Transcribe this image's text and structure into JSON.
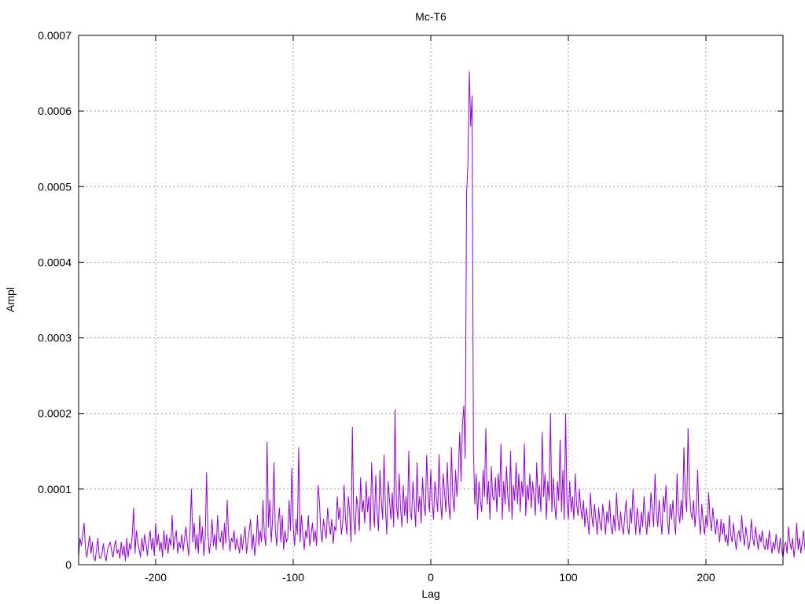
{
  "chart_data": {
    "type": "line",
    "title": "Mc-T6",
    "xlabel": "Lag",
    "ylabel": "Ampl",
    "xlim": [
      -256,
      256
    ],
    "ylim": [
      0,
      0.0007
    ],
    "grid": true,
    "line_color": "#9400d3",
    "x_ticks": [
      {
        "value": -200,
        "label": "-200"
      },
      {
        "value": -100,
        "label": "-100"
      },
      {
        "value": 0,
        "label": "0"
      },
      {
        "value": 100,
        "label": "100"
      },
      {
        "value": 200,
        "label": "200"
      }
    ],
    "y_ticks": [
      {
        "value": 0,
        "label": "0"
      },
      {
        "value": 0.0001,
        "label": "0.0001"
      },
      {
        "value": 0.0002,
        "label": "0.0002"
      },
      {
        "value": 0.0003,
        "label": "0.0003"
      },
      {
        "value": 0.0004,
        "label": "0.0004"
      },
      {
        "value": 0.0005,
        "label": "0.0005"
      },
      {
        "value": 0.0006,
        "label": "0.0006"
      },
      {
        "value": 0.0007,
        "label": "0.0007"
      }
    ],
    "series": [
      {
        "x_start": -256,
        "x_step": 1,
        "values": [
          1e-05,
          3.5e-05,
          2.5e-05,
          4e-05,
          5.5e-05,
          2e-05,
          1e-05,
          2.5e-05,
          3.8e-05,
          1.5e-05,
          3e-05,
          1e-05,
          5e-06,
          2e-05,
          3.5e-05,
          1e-05,
          8e-06,
          1.5e-05,
          2.8e-05,
          1.2e-05,
          5e-06,
          2e-05,
          2.5e-05,
          3e-05,
          1.8e-05,
          1e-05,
          2.5e-05,
          3.2e-05,
          1.5e-05,
          2e-05,
          8e-06,
          3e-05,
          1.2e-05,
          2.5e-05,
          5e-06,
          3.5e-05,
          1e-05,
          2.8e-05,
          2e-05,
          4e-05,
          7.5e-05,
          1.5e-05,
          4.5e-05,
          3e-05,
          2e-05,
          1e-05,
          3.5e-05,
          1.8e-05,
          4e-05,
          2.8e-05,
          1.2e-05,
          3e-05,
          4.5e-05,
          2e-05,
          3.5e-05,
          1.2e-05,
          5.5e-05,
          2.5e-05,
          4e-05,
          1.8e-05,
          3e-05,
          1e-05,
          4.5e-05,
          2e-05,
          4e-05,
          1.5e-05,
          3.5e-05,
          2.5e-05,
          6.5e-05,
          2e-05,
          3.5e-05,
          4.5e-05,
          1.5e-05,
          3e-05,
          2.2e-05,
          4e-05,
          1.8e-05,
          3.5e-05,
          5e-05,
          2.8e-05,
          1.2e-05,
          4.5e-05,
          0.0001,
          3e-05,
          5.5e-05,
          2e-05,
          4e-05,
          1.5e-05,
          6.5e-05,
          2.8e-05,
          5e-05,
          1.2e-05,
          3.5e-05,
          0.000122,
          4e-05,
          1.5e-05,
          3e-05,
          6e-05,
          2.5e-05,
          4e-05,
          2e-05,
          6.5e-05,
          3.5e-05,
          3e-05,
          4.5e-05,
          2e-05,
          5.5e-05,
          2.8e-05,
          8.5e-05,
          4e-05,
          1.8e-05,
          3.5e-05,
          3e-05,
          4.5e-05,
          2e-05,
          3.5e-05,
          2.5e-05,
          1.5e-05,
          4e-05,
          2e-05,
          3.5e-05,
          5e-05,
          1.5e-05,
          3e-05,
          4.5e-05,
          6e-05,
          2e-05,
          4e-05,
          1.2e-05,
          3e-05,
          6.5e-05,
          2.5e-05,
          4.5e-05,
          3e-05,
          8.5e-05,
          4e-05,
          2.5e-05,
          0.000162,
          5e-05,
          8.5e-05,
          3e-05,
          6e-05,
          0.000135,
          4.5e-05,
          2.5e-05,
          5.5e-05,
          7.5e-05,
          3e-05,
          6.5e-05,
          2e-05,
          4.5e-05,
          3e-05,
          3.5e-05,
          8.5e-05,
          4.5e-05,
          0.000128,
          5e-05,
          2.5e-05,
          6e-05,
          4e-05,
          0.000155,
          3e-05,
          6.5e-05,
          4e-05,
          2e-05,
          4.5e-05,
          3.5e-05,
          6.5e-05,
          2.5e-05,
          4e-05,
          5.5e-05,
          3e-05,
          4.5e-05,
          2.5e-05,
          0.000105,
          8.5e-05,
          4.5e-05,
          3e-05,
          6e-05,
          4.5e-05,
          3.5e-05,
          7.5e-05,
          5.5e-05,
          4e-05,
          6e-05,
          2.8e-05,
          5e-05,
          4.5e-05,
          9e-05,
          6e-05,
          7.5e-05,
          4e-05,
          5.5e-05,
          0.000105,
          6e-05,
          4e-05,
          9e-05,
          7e-05,
          3e-05,
          0.000182,
          6e-05,
          4e-05,
          9e-05,
          7.5e-05,
          4.5e-05,
          0.000115,
          7e-05,
          8.5e-05,
          5.5e-05,
          0.00011,
          7e-05,
          9e-05,
          4.5e-05,
          0.000135,
          8e-05,
          5e-05,
          0.000118,
          7e-05,
          4.5e-05,
          0.000125,
          8.5e-05,
          6e-05,
          0.000145,
          7.5e-05,
          4e-05,
          0.00011,
          8.5e-05,
          6e-05,
          9.5e-05,
          5e-05,
          0.000205,
          8e-05,
          6e-05,
          0.00012,
          7.5e-05,
          5e-05,
          0.000105,
          6.5e-05,
          9e-05,
          5.5e-05,
          0.00015,
          7e-05,
          6e-05,
          0.00011,
          8e-05,
          5e-05,
          0.000135,
          7e-05,
          9e-05,
          5.5e-05,
          0.000115,
          8e-05,
          6.5e-05,
          0.000145,
          9e-05,
          7e-05,
          0.000125,
          8.5e-05,
          6e-05,
          0.00011,
          9e-05,
          7e-05,
          0.000145,
          8.5e-05,
          6e-05,
          0.00012,
          9.5e-05,
          7e-05,
          0.000135,
          8e-05,
          6e-05,
          0.000155,
          9e-05,
          7e-05,
          0.000125,
          9e-05,
          0.00012,
          0.000175,
          0.00011,
          0.000185,
          0.00021,
          0.00014,
          0.00049,
          0.00053,
          0.000652,
          0.00058,
          0.00062,
          0.00015,
          8e-05,
          0.00012,
          6e-05,
          0.00011,
          8.5e-05,
          7e-05,
          0.000125,
          9e-05,
          0.00018,
          8e-05,
          0.00011,
          6e-05,
          0.00013,
          9e-05,
          8.5e-05,
          0.000115,
          7e-05,
          0.00012,
          9e-05,
          0.00016,
          6e-05,
          0.00011,
          8e-05,
          0.00013,
          9e-05,
          7e-05,
          0.00015,
          6e-05,
          0.000105,
          8.5e-05,
          0.000135,
          8e-05,
          0.00012,
          7e-05,
          0.00011,
          9e-05,
          0.00016,
          6.5e-05,
          0.000105,
          8.5e-05,
          0.00012,
          7.5e-05,
          0.00011,
          9e-05,
          6.5e-05,
          0.000135,
          8e-05,
          0.000105,
          7e-05,
          0.000175,
          9e-05,
          0.00012,
          6e-05,
          0.00011,
          8.5e-05,
          0.0002,
          7e-05,
          0.000115,
          8e-05,
          6e-05,
          0.00011,
          8.5e-05,
          0.000165,
          7e-05,
          0.000125,
          6e-05,
          0.0002,
          8e-05,
          6e-05,
          0.00011,
          7e-05,
          9e-05,
          6e-05,
          0.00012,
          8e-05,
          6.5e-05,
          0.0001,
          7.5e-05,
          6e-05,
          8.5e-05,
          5e-05,
          7.5e-05,
          6e-05,
          4e-05,
          9.5e-05,
          6.5e-05,
          5e-05,
          8e-05,
          6e-05,
          4e-05,
          7.5e-05,
          5.5e-05,
          4.5e-05,
          8e-05,
          6e-05,
          4e-05,
          7e-05,
          5.5e-05,
          8.5e-05,
          5e-05,
          4e-05,
          6.5e-05,
          4.5e-05,
          9.5e-05,
          6e-05,
          4.5e-05,
          7e-05,
          5e-05,
          4e-05,
          6.5e-05,
          8.5e-05,
          5e-05,
          4e-05,
          7.5e-05,
          5.5e-05,
          0.0001,
          6.5e-05,
          4e-05,
          7.5e-05,
          6e-05,
          4e-05,
          7e-05,
          5e-05,
          9e-05,
          6e-05,
          4e-05,
          7e-05,
          5e-05,
          9.5e-05,
          7.5e-05,
          5e-05,
          0.00012,
          7e-05,
          5e-05,
          8.5e-05,
          6e-05,
          4e-05,
          9e-05,
          7e-05,
          0.000105,
          6e-05,
          4e-05,
          8e-05,
          6e-05,
          8.5e-05,
          5.5e-05,
          4e-05,
          0.00012,
          7e-05,
          5.5e-05,
          8.5e-05,
          6e-05,
          0.000155,
          9e-05,
          7e-05,
          0.00018,
          0.0001,
          7e-05,
          6e-05,
          8.5e-05,
          5e-05,
          7.5e-05,
          0.000125,
          6e-05,
          4e-05,
          8e-05,
          5.5e-05,
          4e-05,
          6.5e-05,
          5e-05,
          9.5e-05,
          6e-05,
          4.5e-05,
          7.5e-05,
          5.5e-05,
          4e-05,
          6e-05,
          4.5e-05,
          3e-05,
          6e-05,
          4e-05,
          5.5e-05,
          3e-05,
          4e-05,
          2.5e-05,
          6.5e-05,
          4e-05,
          3e-05,
          5.5e-05,
          3.5e-05,
          2e-05,
          4e-05,
          4.5e-05,
          3e-05,
          6.5e-05,
          4e-05,
          2.5e-05,
          5e-05,
          3.5e-05,
          2e-05,
          3e-05,
          6e-05,
          3.5e-05,
          2.5e-05,
          5e-05,
          3.5e-05,
          2e-05,
          4e-05,
          3e-05,
          4.5e-05,
          2.5e-05,
          2e-05,
          3.5e-05,
          2e-05,
          4.5e-05,
          3e-05,
          1.5e-05,
          3e-05,
          2e-05,
          4e-05,
          2.5e-05,
          1.5e-05,
          3.5e-05,
          2e-05,
          1e-05,
          2.5e-05,
          3e-05,
          1.5e-05,
          5e-05,
          3e-05,
          2e-05,
          3.5e-05,
          1e-05,
          2.5e-05,
          5.5e-05,
          2e-05,
          3.5e-05,
          1.5e-05,
          3e-05,
          4.5e-05,
          2e-05,
          1e-05,
          3.5e-05,
          2.5e-05,
          1e-05,
          3e-05,
          1.5e-05
        ]
      }
    ]
  }
}
